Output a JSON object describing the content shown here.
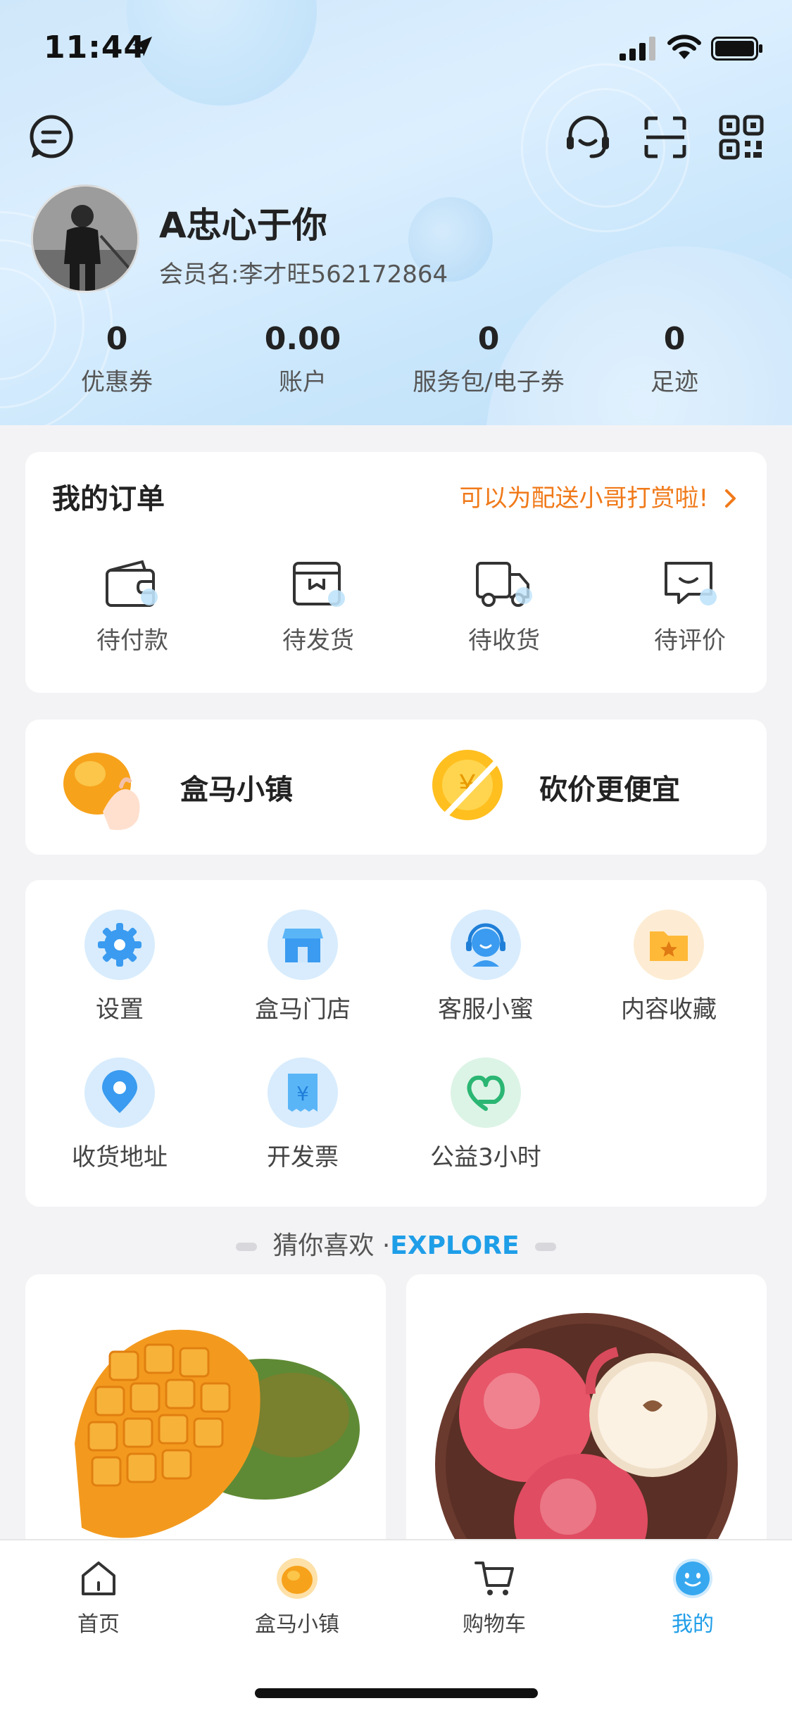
{
  "status_bar": {
    "time": "11:44"
  },
  "profile": {
    "nickname": "A忠心于你",
    "member_name": "会员名:李才旺562172864"
  },
  "stats": [
    {
      "value": "0",
      "label": "优惠券"
    },
    {
      "value": "0.00",
      "label": "账户"
    },
    {
      "value": "0",
      "label": "服务包/电子券"
    },
    {
      "value": "0",
      "label": "足迹"
    }
  ],
  "orders": {
    "title": "我的订单",
    "tip": "可以为配送小哥打赏啦!",
    "items": [
      {
        "label": "待付款",
        "icon": "wallet-icon"
      },
      {
        "label": "待发货",
        "icon": "package-icon"
      },
      {
        "label": "待收货",
        "icon": "truck-icon"
      },
      {
        "label": "待评价",
        "icon": "review-icon"
      }
    ]
  },
  "promos": [
    {
      "label": "盒马小镇",
      "icon": "fruit-hand-icon"
    },
    {
      "label": "砍价更便宜",
      "icon": "coin-cut-icon"
    }
  ],
  "services": [
    {
      "label": "设置",
      "icon": "gear-icon"
    },
    {
      "label": "盒马门店",
      "icon": "store-icon"
    },
    {
      "label": "客服小蜜",
      "icon": "customer-service-icon"
    },
    {
      "label": "内容收藏",
      "icon": "folder-star-icon"
    },
    {
      "label": "收货地址",
      "icon": "location-pin-icon"
    },
    {
      "label": "开发票",
      "icon": "invoice-icon"
    },
    {
      "label": "公益3小时",
      "icon": "charity-heart-icon"
    }
  ],
  "explore": {
    "cn": "猜你喜欢 ·",
    "en": "EXPLORE"
  },
  "products": [
    {
      "icon": "mango-image"
    },
    {
      "icon": "apple-image"
    }
  ],
  "tabbar": [
    {
      "label": "首页",
      "icon": "home-icon"
    },
    {
      "label": "盒马小镇",
      "icon": "hema-town-icon"
    },
    {
      "label": "购物车",
      "icon": "cart-icon"
    },
    {
      "label": "我的",
      "icon": "me-smile-icon",
      "active": true
    }
  ],
  "colors": {
    "accent": "#1f9ee8",
    "tip": "#f07a1a",
    "background": "#f3f3f5"
  }
}
